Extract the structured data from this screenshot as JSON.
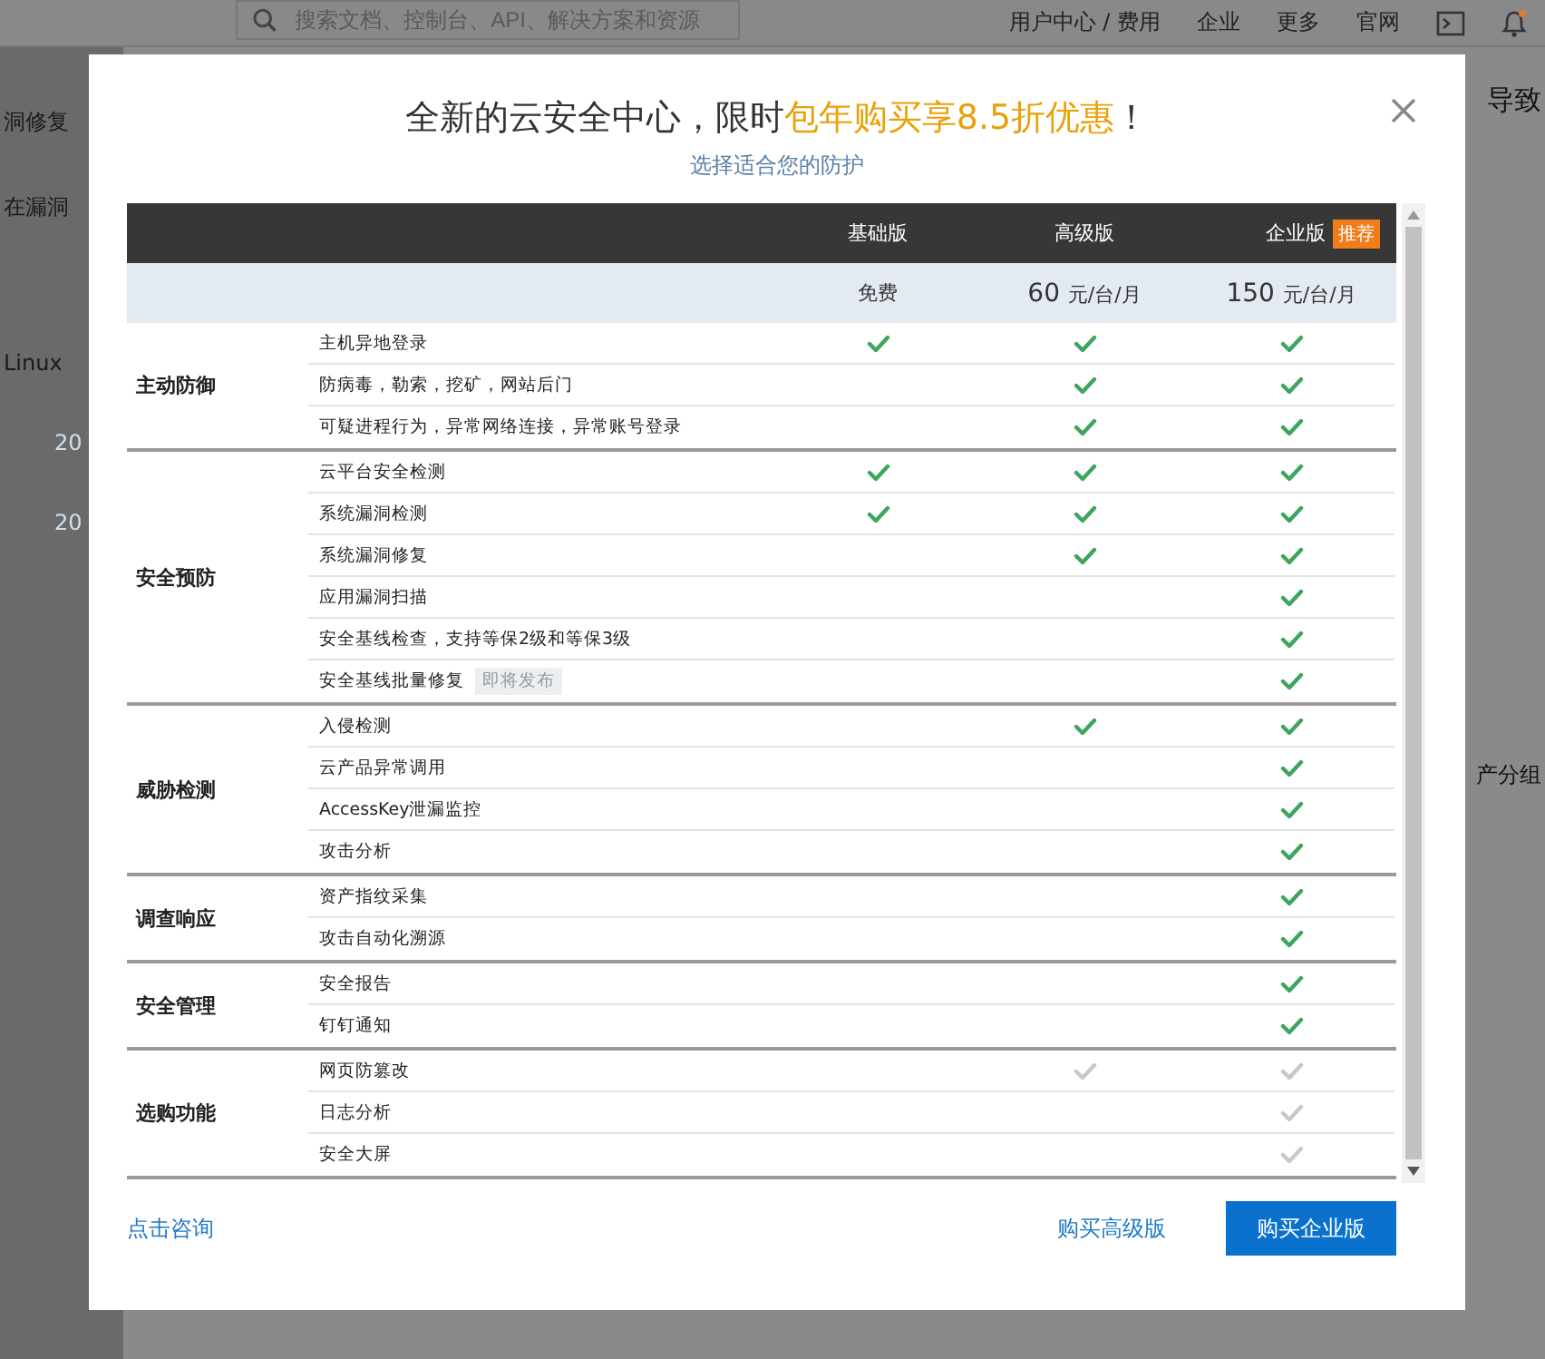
{
  "background": {
    "search": {
      "placeholder": "搜索文档、控制台、API、解决方案和资源"
    },
    "nav": [
      "用户中心 / 费用",
      "企业",
      "更多",
      "官网"
    ],
    "left_fragments": [
      "洞修复",
      "在漏洞",
      "Linux",
      "20",
      "20"
    ],
    "right_fragments": [
      "导致",
      "产分组"
    ]
  },
  "dialog": {
    "title": "全新的云安全中心，限时",
    "title_highlight": "包年购买享8.5折优惠",
    "title_end": "！",
    "subtitle": "选择适合您的防护",
    "plans": [
      {
        "name": "基础版",
        "price": "免费"
      },
      {
        "name": "高级版",
        "price": "60",
        "unit": "元/台/月"
      },
      {
        "name": "企业版",
        "price": "150",
        "unit": "元/台/月",
        "badge": "推荐"
      }
    ],
    "groups": [
      {
        "name": "主动防御",
        "optional": false,
        "features": [
          {
            "name": "主机异地登录",
            "included": [
              true,
              true,
              true
            ]
          },
          {
            "name": "防病毒，勒索，挖矿，网站后门",
            "included": [
              false,
              true,
              true
            ]
          },
          {
            "name": "可疑进程行为，异常网络连接，异常账号登录",
            "included": [
              false,
              true,
              true
            ]
          }
        ]
      },
      {
        "name": "安全预防",
        "optional": false,
        "features": [
          {
            "name": "云平台安全检测",
            "included": [
              true,
              true,
              true
            ]
          },
          {
            "name": "系统漏洞检测",
            "included": [
              true,
              true,
              true
            ]
          },
          {
            "name": "系统漏洞修复",
            "included": [
              false,
              true,
              true
            ]
          },
          {
            "name": "应用漏洞扫描",
            "included": [
              false,
              false,
              true
            ]
          },
          {
            "name": "安全基线检查，支持等保2级和等保3级",
            "included": [
              false,
              false,
              true
            ]
          },
          {
            "name": "安全基线批量修复",
            "badge": "即将发布",
            "included": [
              false,
              false,
              true
            ]
          }
        ]
      },
      {
        "name": "威胁检测",
        "optional": false,
        "features": [
          {
            "name": "入侵检测",
            "included": [
              false,
              true,
              true
            ]
          },
          {
            "name": "云产品异常调用",
            "included": [
              false,
              false,
              true
            ]
          },
          {
            "name": "AccessKey泄漏监控",
            "included": [
              false,
              false,
              true
            ]
          },
          {
            "name": "攻击分析",
            "included": [
              false,
              false,
              true
            ]
          }
        ]
      },
      {
        "name": "调查响应",
        "optional": false,
        "features": [
          {
            "name": "资产指纹采集",
            "included": [
              false,
              false,
              true
            ]
          },
          {
            "name": "攻击自动化溯源",
            "included": [
              false,
              false,
              true
            ]
          }
        ]
      },
      {
        "name": "安全管理",
        "optional": false,
        "features": [
          {
            "name": "安全报告",
            "included": [
              false,
              false,
              true
            ]
          },
          {
            "name": "钉钉通知",
            "included": [
              false,
              false,
              true
            ]
          }
        ]
      },
      {
        "name": "选购功能",
        "optional": true,
        "features": [
          {
            "name": "网页防篡改",
            "included": [
              false,
              true,
              true
            ]
          },
          {
            "name": "日志分析",
            "included": [
              false,
              false,
              true
            ]
          },
          {
            "name": "安全大屏",
            "included": [
              false,
              false,
              true
            ]
          }
        ]
      }
    ],
    "consult_link": "点击咨询",
    "buy_advanced": "购买高级版",
    "buy_enterprise": "购买企业版"
  }
}
